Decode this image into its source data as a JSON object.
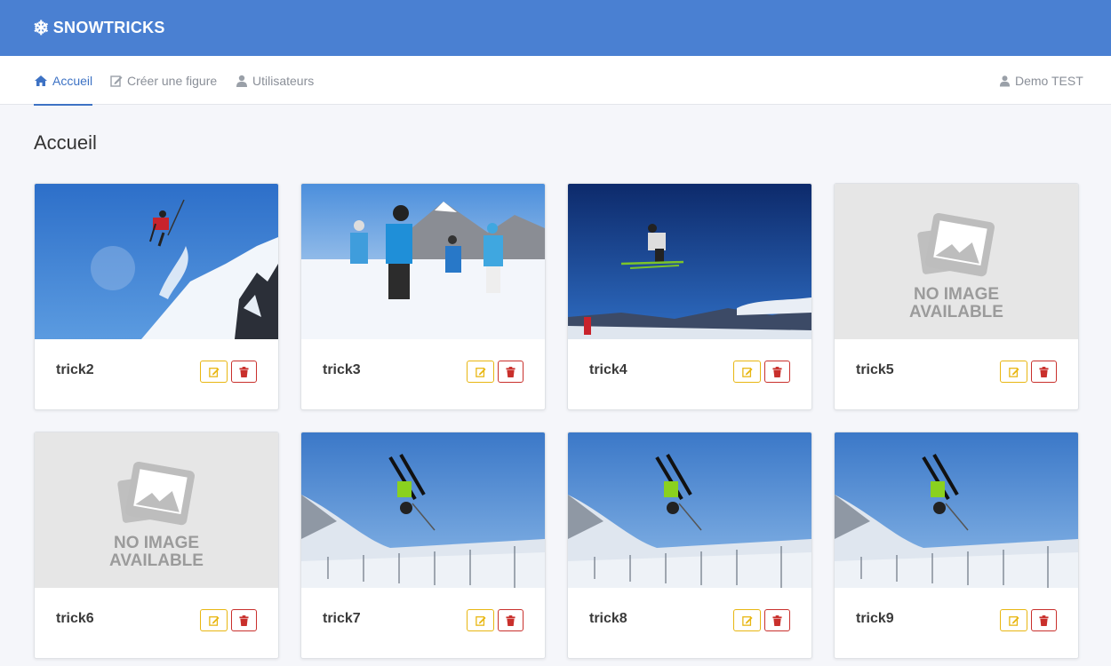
{
  "brand": {
    "name": "SNOWTRICKS"
  },
  "nav": {
    "items": [
      {
        "label": "Accueil",
        "icon": "home-icon",
        "active": true
      },
      {
        "label": "Créer une figure",
        "icon": "edit-icon",
        "active": false
      },
      {
        "label": "Utilisateurs",
        "icon": "user-icon",
        "active": false
      }
    ],
    "user": {
      "label": "Demo TEST",
      "icon": "user-icon"
    }
  },
  "page": {
    "title": "Accueil"
  },
  "tricks": [
    {
      "name": "trick2",
      "image": "skier-jump-mountain"
    },
    {
      "name": "trick3",
      "image": "family-skiing"
    },
    {
      "name": "trick4",
      "image": "freestyle-skier-air"
    },
    {
      "name": "trick5",
      "image": "no-image"
    },
    {
      "name": "trick6",
      "image": "no-image"
    },
    {
      "name": "trick7",
      "image": "skier-flip"
    },
    {
      "name": "trick8",
      "image": "skier-flip"
    },
    {
      "name": "trick9",
      "image": "skier-flip"
    }
  ],
  "placeholder": {
    "line1": "NO IMAGE",
    "line2": "AVAILABLE"
  },
  "colors": {
    "topbar": "#4a80d2",
    "accent": "#3d72c4",
    "edit": "#e8b611",
    "delete": "#c9302c"
  }
}
